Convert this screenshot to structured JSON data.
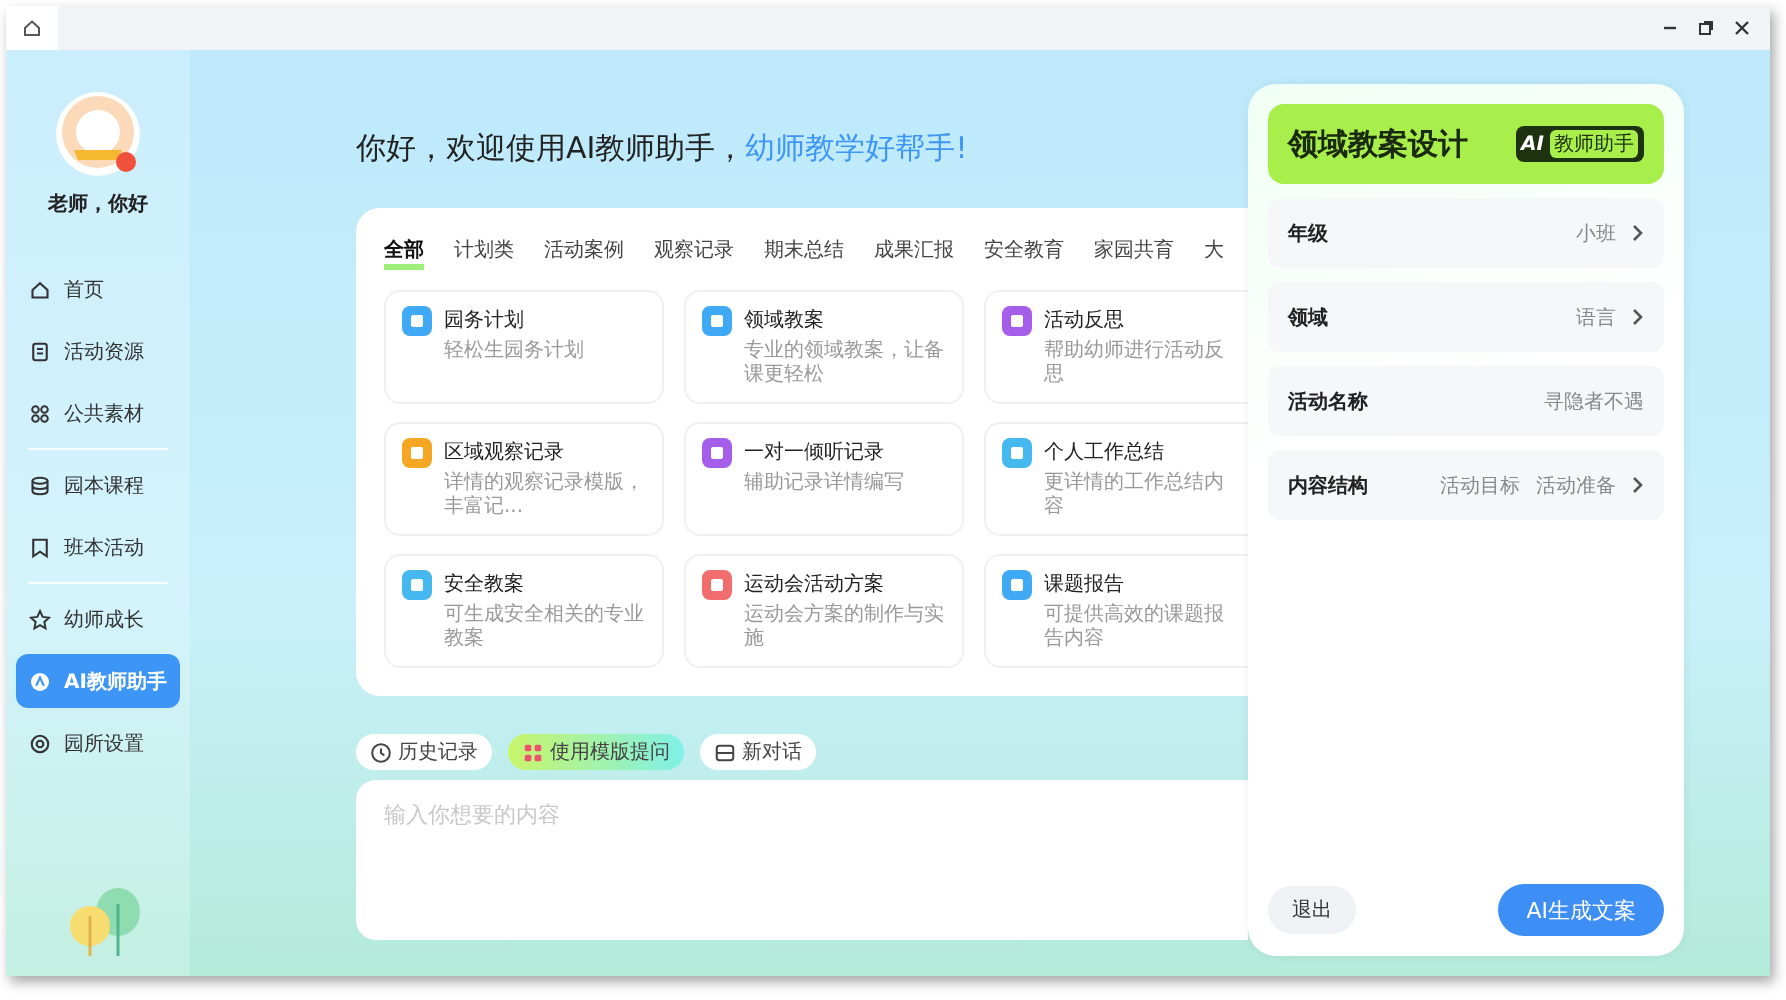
{
  "sidebar": {
    "greeting": "老师，你好",
    "items": [
      {
        "label": "首页",
        "selected": false
      },
      {
        "label": "活动资源",
        "selected": false
      },
      {
        "label": "公共素材",
        "selected": false
      },
      {
        "label": "园本课程",
        "selected": false
      },
      {
        "label": "班本活动",
        "selected": false
      },
      {
        "label": "幼师成长",
        "selected": false
      },
      {
        "label": "AI教师助手",
        "selected": true
      },
      {
        "label": "园所设置",
        "selected": false
      }
    ]
  },
  "header": {
    "title": "你好，欢迎使用AI教师助手，",
    "slogan": "幼师教学好帮手!"
  },
  "tabs": [
    {
      "label": "全部",
      "selected": true
    },
    {
      "label": "计划类",
      "selected": false
    },
    {
      "label": "活动案例",
      "selected": false
    },
    {
      "label": "观察记录",
      "selected": false
    },
    {
      "label": "期末总结",
      "selected": false
    },
    {
      "label": "成果汇报",
      "selected": false
    },
    {
      "label": "安全教育",
      "selected": false
    },
    {
      "label": "家园共育",
      "selected": false
    },
    {
      "label": "大",
      "selected": false
    }
  ],
  "cards": [
    {
      "title": "园务计划",
      "desc": "轻松生园务计划",
      "color": "#3fa9f5"
    },
    {
      "title": "领域教案",
      "desc": "专业的领域教案，让备课更轻松",
      "color": "#3fa9f5"
    },
    {
      "title": "活动反思",
      "desc": "帮助幼师进行活动反思",
      "color": "#a55eea"
    },
    {
      "title": "区域观察记录",
      "desc": "详情的观察记录模版，丰富记...",
      "color": "#f5a623"
    },
    {
      "title": "一对一倾听记录",
      "desc": "辅助记录详情编写",
      "color": "#a55eea"
    },
    {
      "title": "个人工作总结",
      "desc": "更详情的工作总结内容",
      "color": "#45b8f0"
    },
    {
      "title": "安全教案",
      "desc": "可生成安全相关的专业教案",
      "color": "#45b8f0"
    },
    {
      "title": "运动会活动方案",
      "desc": "运动会方案的制作与实施",
      "color": "#f26d6d"
    },
    {
      "title": "课题报告",
      "desc": "可提供高效的课题报告内容",
      "color": "#3fa9f5"
    }
  ],
  "chips": [
    {
      "label": "历史记录",
      "selected": false
    },
    {
      "label": "使用模版提问",
      "selected": true
    },
    {
      "label": "新对话",
      "selected": false
    }
  ],
  "input": {
    "placeholder": "输入你想要的内容"
  },
  "panel": {
    "title": "领域教案设计",
    "badge_ai": "AI",
    "badge_text": "教师助手",
    "rows": [
      {
        "label": "年级",
        "values": [
          "小班"
        ],
        "has_arrow": true
      },
      {
        "label": "领域",
        "values": [
          "语言"
        ],
        "has_arrow": true
      },
      {
        "label": "活动名称",
        "values": [
          "寻隐者不遇"
        ],
        "has_arrow": false
      },
      {
        "label": "内容结构",
        "values": [
          "活动目标",
          "活动准备"
        ],
        "has_arrow": true
      }
    ],
    "buttons": [
      {
        "label": "退出",
        "kind": "secondary"
      },
      {
        "label": "AI生成文案",
        "kind": "primary"
      }
    ]
  }
}
